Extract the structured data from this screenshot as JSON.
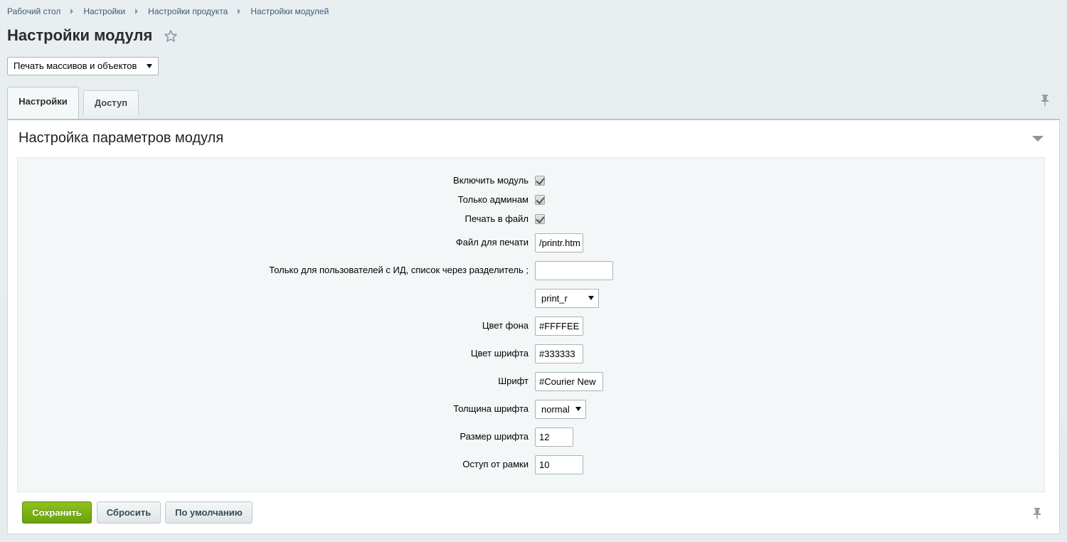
{
  "breadcrumb": [
    "Рабочий стол",
    "Настройки",
    "Настройки продукта",
    "Настройки модулей"
  ],
  "page_title": "Настройки модуля",
  "module_select": {
    "value": "Печать массивов и объектов"
  },
  "tabs": [
    {
      "label": "Настройки",
      "active": true
    },
    {
      "label": "Доступ",
      "active": false
    }
  ],
  "section_title": "Настройка параметров модуля",
  "form": {
    "enable_module": {
      "label": "Включить модуль",
      "checked": true
    },
    "admins_only": {
      "label": "Только админам",
      "checked": true
    },
    "print_to_file": {
      "label": "Печать в файл",
      "checked": true
    },
    "print_file": {
      "label": "Файл для печати",
      "value": "/printr.htm"
    },
    "user_ids": {
      "label": "Только для пользователей с ИД, список через разделитель ;",
      "value": ""
    },
    "print_function": {
      "value": "print_r"
    },
    "bg_color": {
      "label": "Цвет фона",
      "value": "#FFFFEE"
    },
    "font_color": {
      "label": "Цвет шрифта",
      "value": "#333333"
    },
    "font": {
      "label": "Шрифт",
      "value": "#Courier New"
    },
    "font_weight": {
      "label": "Толщина шрифта",
      "value": "normal"
    },
    "font_size": {
      "label": "Размер шрифта",
      "value": "12"
    },
    "padding": {
      "label": "Оступ от рамки",
      "value": "10"
    }
  },
  "buttons": {
    "save": "Сохранить",
    "reset": "Сбросить",
    "default": "По умолчанию"
  },
  "icons": {
    "favorite": "star-icon",
    "pin": "pin-icon",
    "collapse": "chevron-down-icon"
  },
  "colors": {
    "save_button": "#7ab317",
    "link": "#3a5b79",
    "background": "#e8edef"
  }
}
